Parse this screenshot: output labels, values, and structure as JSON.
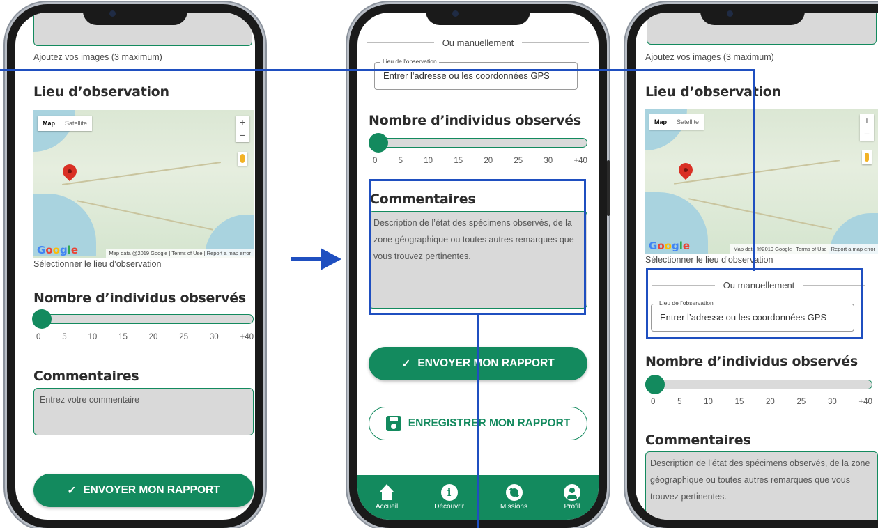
{
  "colors": {
    "accent": "#138a5e",
    "annotation": "#1f4fc0",
    "field_bg": "#d9d9d9"
  },
  "phone1": {
    "images_hint": "Ajoutez vos images (3 maximum)",
    "location_title": "Lieu d’observation",
    "map": {
      "type_map": "Map",
      "type_satellite": "Satellite",
      "zoom_in": "+",
      "zoom_out": "−",
      "logo": "Google",
      "footer": "Map data @2019 Google | Terms of Use | Report a map error"
    },
    "location_caption": "Sélectionner le lieu d’observation",
    "count_title": "Nombre d’individus observés",
    "slider_value": 0,
    "ticks": [
      "0",
      "5",
      "10",
      "15",
      "20",
      "25",
      "30",
      "+40"
    ],
    "comments_title": "Commentaires",
    "comments_placeholder": "Entrez votre commentaire",
    "submit_icon": "✓",
    "submit_label": "ENVOYER MON RAPPORT"
  },
  "phone2": {
    "manual_label": "Ou manuellement",
    "field_legend": "Lieu de l'observation",
    "field_value": "Entrer l'adresse ou les coordonnées GPS",
    "count_title": "Nombre d’individus observés",
    "slider_value": 0,
    "ticks": [
      "0",
      "5",
      "10",
      "15",
      "20",
      "25",
      "30",
      "+40"
    ],
    "comments_title": "Commentaires",
    "comments_text": "Description de l’état des spécimens observés, de la zone géographique ou toutes autres remarques que vous trouvez pertinentes.",
    "submit_icon": "✓",
    "submit_label": "ENVOYER MON RAPPORT",
    "save_label": "ENREGISTRER MON RAPPORT",
    "nav": {
      "home": "Accueil",
      "discover": "Découvrir",
      "missions": "Missions",
      "profile": "Profil"
    },
    "info_glyph": "i"
  },
  "phone3": {
    "images_hint": "Ajoutez vos images (3 maximum)",
    "location_title": "Lieu d’observation",
    "map": {
      "type_map": "Map",
      "type_satellite": "Satellite",
      "zoom_in": "+",
      "zoom_out": "−",
      "logo": "Google",
      "footer": "Map data @2019 Google | Terms of Use | Report a map error"
    },
    "location_caption": "Sélectionner le lieu d’observation",
    "manual_label": "Ou manuellement",
    "field_legend": "Lieu de l'observation",
    "field_value": "Entrer l’adresse ou les coordonnées GPS",
    "count_title": "Nombre d’individus observés",
    "slider_value": 0,
    "ticks": [
      "0",
      "5",
      "10",
      "15",
      "20",
      "25",
      "30",
      "+40"
    ],
    "comments_title": "Commentaires",
    "comments_text": "Description de l’état des spécimens observés, de la zone géographique ou toutes autres remarques que vous trouvez pertinentes."
  }
}
